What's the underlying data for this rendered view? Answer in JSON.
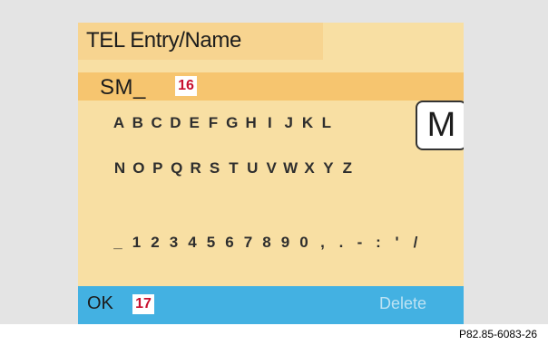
{
  "header": {
    "title": "TEL Entry/Name"
  },
  "entry": {
    "value": "SM_",
    "callout": "16"
  },
  "keyboard": {
    "row1": [
      "A",
      "B",
      "C",
      "D",
      "E",
      "F",
      "G",
      "H",
      "I",
      "J",
      "K",
      "L"
    ],
    "selected": "M",
    "row2": [
      "N",
      "O",
      "P",
      "Q",
      "R",
      "S",
      "T",
      "U",
      "V",
      "W",
      "X",
      "Y",
      "Z"
    ],
    "row3": [
      "_",
      "1",
      "2",
      "3",
      "4",
      "5",
      "6",
      "7",
      "8",
      "9",
      "0",
      ",",
      ".",
      "-",
      ":",
      "'",
      "/"
    ]
  },
  "footer": {
    "ok_label": "OK",
    "ok_callout": "17",
    "delete_label": "Delete"
  },
  "figure_code": "P82.85-6083-26"
}
